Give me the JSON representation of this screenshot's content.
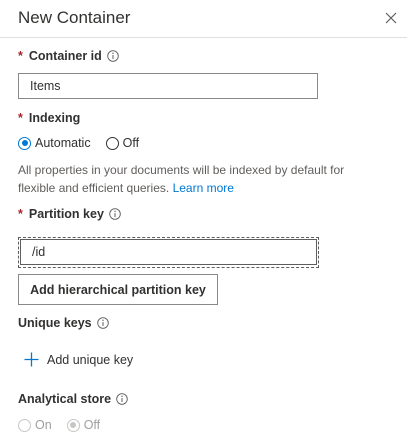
{
  "panel": {
    "title": "New Container",
    "close_icon": "close-icon"
  },
  "container_id": {
    "label": "Container id",
    "required_mark": "*",
    "value": "Items"
  },
  "indexing": {
    "label": "Indexing",
    "required_mark": "*",
    "options": [
      "Automatic",
      "Off"
    ],
    "selected": "Automatic",
    "description": "All properties in your documents will be indexed by default for flexible and efficient queries.",
    "learn_more": "Learn more"
  },
  "partition_key": {
    "label": "Partition key",
    "required_mark": "*",
    "value": "/id",
    "hierarchical_button": "Add hierarchical partition key"
  },
  "unique_keys": {
    "label": "Unique keys",
    "add_label": "Add unique key"
  },
  "analytical_store": {
    "label": "Analytical store",
    "options": [
      "On",
      "Off"
    ],
    "selected": "Off",
    "disabled": true
  },
  "colors": {
    "accent": "#0078d4",
    "required": "#a4262c",
    "border": "#8a8886"
  }
}
